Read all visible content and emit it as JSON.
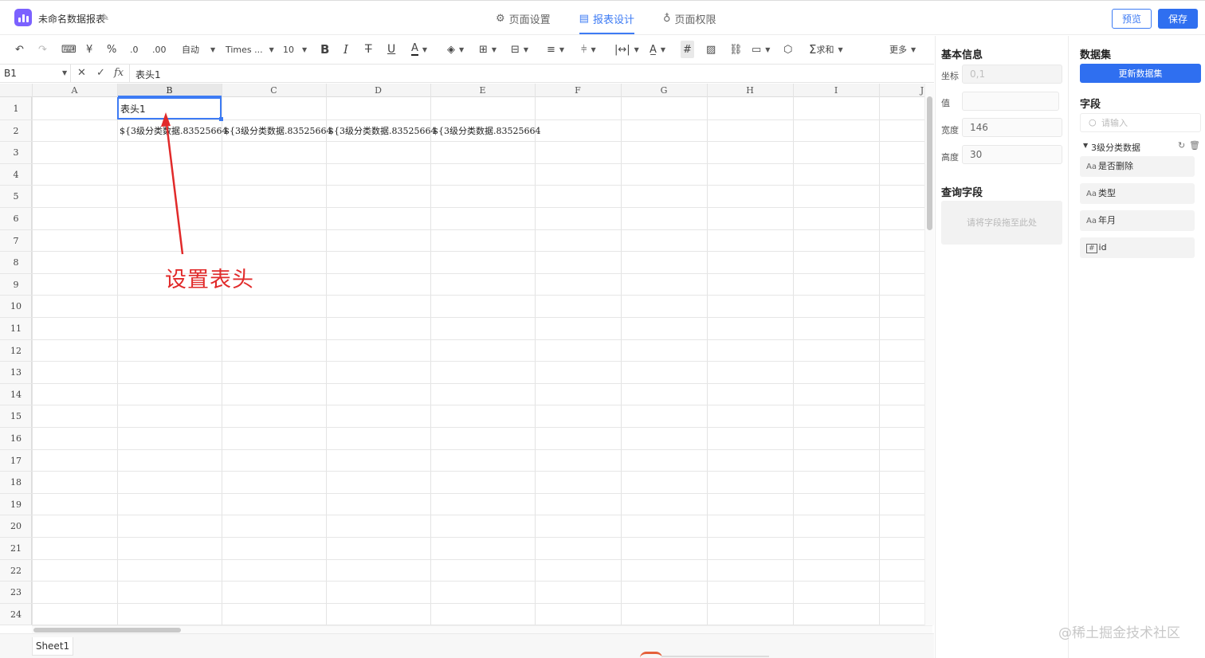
{
  "header": {
    "title": "未命名数据报表",
    "tabs": [
      {
        "label": "页面设置",
        "icon": "gear-icon"
      },
      {
        "label": "报表设计",
        "icon": "report-design-icon"
      },
      {
        "label": "页面权限",
        "icon": "lock-icon"
      }
    ],
    "active_tab": "报表设计",
    "preview_label": "预览",
    "save_label": "保存",
    "accent_color": "#2f6ff0"
  },
  "toolbar": {
    "wrap_label": "自动",
    "font_label": "Times ...",
    "size_label": "10",
    "currency_label": "¥",
    "percent_label": "%",
    "sum_label": "求和",
    "more_label": "更多"
  },
  "formula_bar": {
    "cell_ref": "B1",
    "value": "表头1"
  },
  "grid": {
    "columns": [
      "A",
      "B",
      "C",
      "D",
      "E",
      "F",
      "G",
      "H",
      "I",
      "J"
    ],
    "rows": [
      "1",
      "2",
      "3",
      "4",
      "5",
      "6",
      "7",
      "8",
      "9",
      "10",
      "11",
      "12",
      "13",
      "14",
      "15",
      "16",
      "17",
      "18",
      "19",
      "20",
      "21",
      "22",
      "23",
      "24"
    ],
    "cells": {
      "B1": "表头1",
      "B2": "${3级分类数据.83525664",
      "C2": "${3级分类数据.83525664",
      "D2": "${3级分类数据.83525664",
      "E2": "${3级分类数据.83525664"
    },
    "annotation": "设置表头"
  },
  "sheets": [
    "Sheet1"
  ],
  "basic_info": {
    "title": "基本信息",
    "coord_label": "坐标",
    "coord_value": "0,1",
    "value_label": "值",
    "value_value": "",
    "width_label": "宽度",
    "width_value": "146",
    "height_label": "高度",
    "height_value": "30",
    "query_title": "查询字段",
    "dropzone_text": "请将字段拖至此处"
  },
  "dataset": {
    "title": "数据集",
    "refresh_label": "更新数据集",
    "fields_title": "字段",
    "search_placeholder": "请输入",
    "group_name": "3级分类数据",
    "fields": [
      {
        "type": "Aa",
        "name": "是否删除"
      },
      {
        "type": "Aa",
        "name": "类型"
      },
      {
        "type": "Aa",
        "name": "年月"
      },
      {
        "type": "#",
        "name": "id"
      }
    ]
  },
  "watermark": "@稀土掘金技术社区"
}
